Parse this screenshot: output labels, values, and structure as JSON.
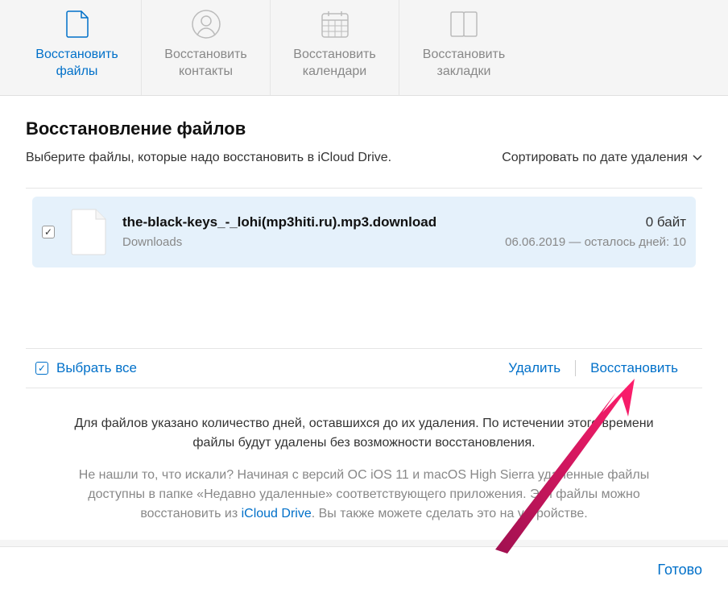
{
  "tabs": [
    {
      "label": "Восстановить\nфайлы",
      "active": true
    },
    {
      "label": "Восстановить\nконтакты",
      "active": false
    },
    {
      "label": "Восстановить\nкалендари",
      "active": false
    },
    {
      "label": "Восстановить\nзакладки",
      "active": false
    }
  ],
  "page_title": "Восстановление файлов",
  "instruction": "Выберите файлы, которые надо восстановить в iCloud Drive.",
  "sort_label": "Сортировать по дате удаления",
  "files": [
    {
      "checked": true,
      "name": "the-black-keys_-_lohi(mp3hiti.ru).mp3.download",
      "location": "Downloads",
      "size": "0 байт",
      "date": "06.06.2019 — осталось дней: 10"
    }
  ],
  "select_all_label": "Выбрать все",
  "select_all_checked": true,
  "actions": {
    "delete": "Удалить",
    "restore": "Восстановить"
  },
  "help": {
    "primary": "Для файлов указано количество дней, оставшихся до их удаления. По истечении этого времени файлы будут удалены без возможности восстановления.",
    "secondary_pre": "Не нашли то, что искали? Начиная с версий ОС iOS 11 и macOS High Sierra удаленные файлы доступны в папке «Недавно удаленные» соответствующего приложения. Эти файлы можно восстановить из ",
    "secondary_link": "iCloud Drive",
    "secondary_post": ". Вы также можете сделать это на устройстве."
  },
  "done_label": "Готово"
}
